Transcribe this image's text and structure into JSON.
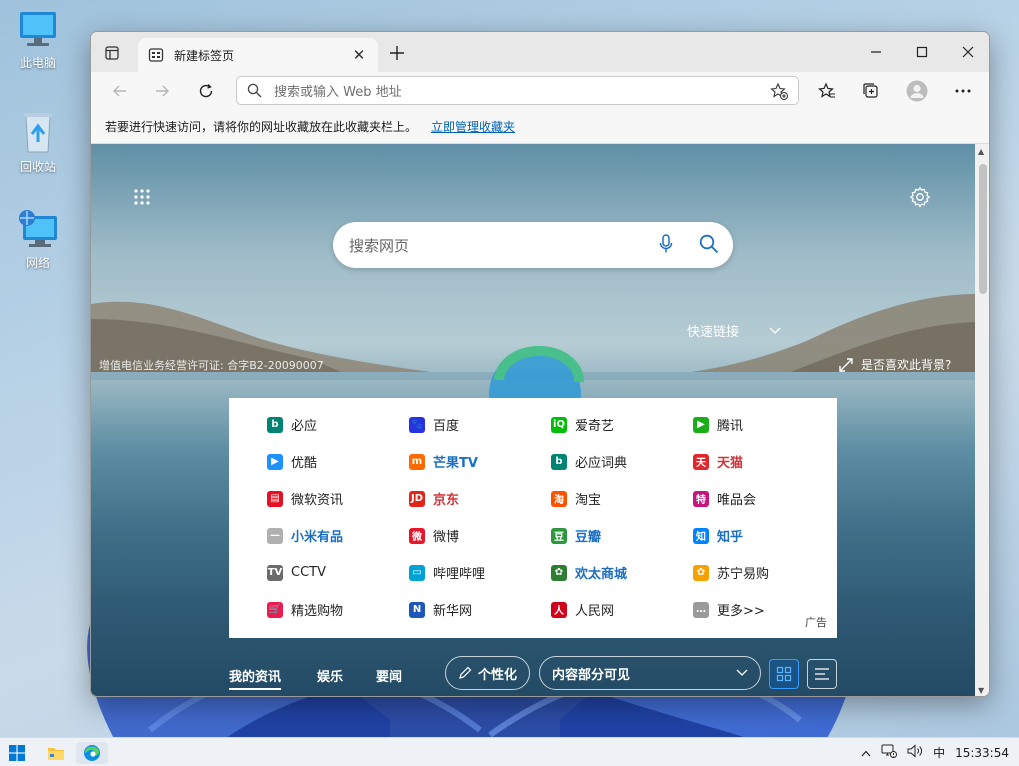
{
  "colors": {
    "accent": "#0078d4",
    "link_blue": "#1b6fc3",
    "tab_bg": "#f7f7f7",
    "titlebar_bg": "#e8e8e8"
  },
  "desktop": {
    "icons": [
      {
        "label": "此电脑",
        "icon": "computer-icon"
      },
      {
        "label": "回收站",
        "icon": "recycle-bin-icon"
      },
      {
        "label": "网络",
        "icon": "network-icon"
      }
    ]
  },
  "browser": {
    "tab": {
      "title": "新建标签页"
    },
    "address_bar": {
      "placeholder": "搜索或输入 Web 地址"
    },
    "favorites_bar": {
      "message": "若要进行快速访问，请将你的网址收藏放在此收藏夹栏上。",
      "link": "立即管理收藏夹"
    }
  },
  "newtab": {
    "search_placeholder": "搜索网页",
    "quick_links_label": "快速链接",
    "license_text": "增值电信业务经营许可证: 合字B2-20090007",
    "like_background": "是否喜欢此背景?",
    "ad_label": "广告",
    "links": [
      {
        "label": "必应",
        "icon": "bing-icon",
        "color": "#008373",
        "glyph": "b",
        "style": ""
      },
      {
        "label": "百度",
        "icon": "baidu-paw-icon",
        "color": "#2932e1",
        "glyph": "🐾",
        "style": ""
      },
      {
        "label": "爱奇艺",
        "icon": "iqiyi-icon",
        "color": "#00be06",
        "glyph": "iQ",
        "style": ""
      },
      {
        "label": "腾讯",
        "icon": "tencent-play-icon",
        "color": "#1aad19",
        "glyph": "▶",
        "style": ""
      },
      {
        "label": "优酷",
        "icon": "youku-icon",
        "color": "#1e90ff",
        "glyph": "▶",
        "style": ""
      },
      {
        "label": "芒果TV",
        "icon": "mango-tv-icon",
        "color": "#ff6a00",
        "glyph": "m",
        "style": "hl"
      },
      {
        "label": "必应词典",
        "icon": "bing-dictionary-icon",
        "color": "#008373",
        "glyph": "b",
        "style": ""
      },
      {
        "label": "天猫",
        "icon": "tmall-icon",
        "color": "#e3262b",
        "glyph": "天",
        "style": "red"
      },
      {
        "label": "微软资讯",
        "icon": "msn-news-icon",
        "color": "#e81123",
        "glyph": "▤",
        "style": ""
      },
      {
        "label": "京东",
        "icon": "jd-icon",
        "color": "#e1251b",
        "glyph": "JD",
        "style": "red"
      },
      {
        "label": "淘宝",
        "icon": "taobao-icon",
        "color": "#ff5000",
        "glyph": "淘",
        "style": ""
      },
      {
        "label": "唯品会",
        "icon": "vip-icon",
        "color": "#c8157c",
        "glyph": "特",
        "style": ""
      },
      {
        "label": "小米有品",
        "icon": "xiaomi-youpin-icon",
        "color": "#b0b0b0",
        "glyph": "—",
        "style": "hl"
      },
      {
        "label": "微博",
        "icon": "weibo-icon",
        "color": "#e6162d",
        "glyph": "微",
        "style": ""
      },
      {
        "label": "豆瓣",
        "icon": "douban-icon",
        "color": "#2e963d",
        "glyph": "豆",
        "style": "hl"
      },
      {
        "label": "知乎",
        "icon": "zhihu-icon",
        "color": "#0084ff",
        "glyph": "知",
        "style": "hl"
      },
      {
        "label": "CCTV",
        "icon": "cctv-icon",
        "color": "#6b6b6b",
        "glyph": "TV",
        "style": ""
      },
      {
        "label": "哔哩哔哩",
        "icon": "bilibili-icon",
        "color": "#00a1d6",
        "glyph": "▭",
        "style": ""
      },
      {
        "label": "欢太商城",
        "icon": "heytap-icon",
        "color": "#2e7d32",
        "glyph": "✿",
        "style": "hl"
      },
      {
        "label": "苏宁易购",
        "icon": "suning-icon",
        "color": "#f5a100",
        "glyph": "✿",
        "style": ""
      },
      {
        "label": "精选购物",
        "icon": "shopping-cart-icon",
        "color": "#e81c4f",
        "glyph": "🛒",
        "style": ""
      },
      {
        "label": "新华网",
        "icon": "xinhua-icon",
        "color": "#1f57b8",
        "glyph": "N",
        "style": ""
      },
      {
        "label": "人民网",
        "icon": "people-daily-icon",
        "color": "#d0021b",
        "glyph": "人",
        "style": ""
      },
      {
        "label": "更多>>",
        "icon": "more-icon",
        "color": "#9a9a9a",
        "glyph": "…",
        "style": ""
      }
    ],
    "feed": {
      "tabs": [
        "我的资讯",
        "娱乐",
        "要闻"
      ],
      "personalize_label": "个性化",
      "visibility_select": "内容部分可见"
    }
  },
  "taskbar": {
    "ime_label": "中",
    "time": "15:33:54"
  }
}
